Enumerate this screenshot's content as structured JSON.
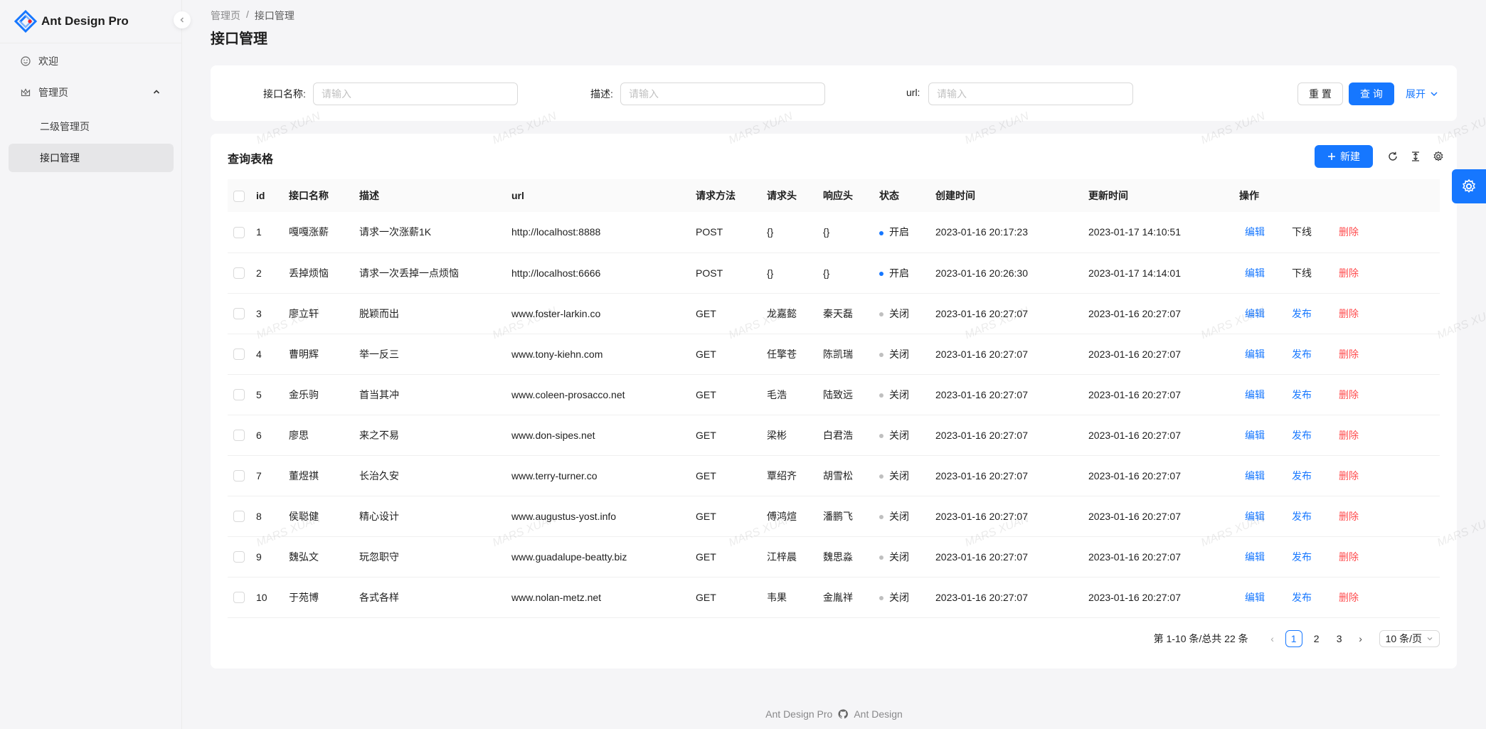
{
  "app": {
    "title": "Ant Design Pro"
  },
  "sidebar": {
    "items": [
      {
        "label": "欢迎",
        "icon": "smile-icon"
      },
      {
        "label": "管理页",
        "icon": "crown-icon"
      },
      {
        "label": "二级管理页"
      },
      {
        "label": "接口管理"
      }
    ]
  },
  "breadcrumb": [
    "管理页",
    "/",
    "接口管理"
  ],
  "page_title": "接口管理",
  "search": {
    "name_label": "接口名称:",
    "desc_label": "描述:",
    "url_label": "url:",
    "placeholder": "请输入",
    "reset": "重 置",
    "query": "查 询",
    "expand": "展开"
  },
  "table": {
    "title": "查询表格",
    "new_button": "新建",
    "columns": [
      "id",
      "接口名称",
      "描述",
      "url",
      "请求方法",
      "请求头",
      "响应头",
      "状态",
      "创建时间",
      "更新时间",
      "操作"
    ],
    "rows": [
      {
        "id": "1",
        "name": "嘎嘎涨薪",
        "desc": "请求一次涨薪1K",
        "url": "http://localhost:8888",
        "method": "POST",
        "req": "{}",
        "res": "{}",
        "status": "开启",
        "on": true,
        "created": "2023-01-16 20:17:23",
        "updated": "2023-01-17 14:10:51",
        "op1": "编辑",
        "op2": "下线",
        "op3": "删除"
      },
      {
        "id": "2",
        "name": "丢掉烦恼",
        "desc": "请求一次丢掉一点烦恼",
        "url": "http://localhost:6666",
        "method": "POST",
        "req": "{}",
        "res": "{}",
        "status": "开启",
        "on": true,
        "created": "2023-01-16 20:26:30",
        "updated": "2023-01-17 14:14:01",
        "op1": "编辑",
        "op2": "下线",
        "op3": "删除"
      },
      {
        "id": "3",
        "name": "廖立轩",
        "desc": "脱颖而出",
        "url": "www.foster-larkin.co",
        "method": "GET",
        "req": "龙嘉懿",
        "res": "秦天磊",
        "status": "关闭",
        "on": false,
        "created": "2023-01-16 20:27:07",
        "updated": "2023-01-16 20:27:07",
        "op1": "编辑",
        "op2": "发布",
        "op3": "删除"
      },
      {
        "id": "4",
        "name": "曹明辉",
        "desc": "举一反三",
        "url": "www.tony-kiehn.com",
        "method": "GET",
        "req": "任擎苍",
        "res": "陈凯瑞",
        "status": "关闭",
        "on": false,
        "created": "2023-01-16 20:27:07",
        "updated": "2023-01-16 20:27:07",
        "op1": "编辑",
        "op2": "发布",
        "op3": "删除"
      },
      {
        "id": "5",
        "name": "金乐驹",
        "desc": "首当其冲",
        "url": "www.coleen-prosacco.net",
        "method": "GET",
        "req": "毛浩",
        "res": "陆致远",
        "status": "关闭",
        "on": false,
        "created": "2023-01-16 20:27:07",
        "updated": "2023-01-16 20:27:07",
        "op1": "编辑",
        "op2": "发布",
        "op3": "删除"
      },
      {
        "id": "6",
        "name": "廖思",
        "desc": "来之不易",
        "url": "www.don-sipes.net",
        "method": "GET",
        "req": "梁彬",
        "res": "白君浩",
        "status": "关闭",
        "on": false,
        "created": "2023-01-16 20:27:07",
        "updated": "2023-01-16 20:27:07",
        "op1": "编辑",
        "op2": "发布",
        "op3": "删除"
      },
      {
        "id": "7",
        "name": "董煜祺",
        "desc": "长治久安",
        "url": "www.terry-turner.co",
        "method": "GET",
        "req": "覃绍齐",
        "res": "胡雪松",
        "status": "关闭",
        "on": false,
        "created": "2023-01-16 20:27:07",
        "updated": "2023-01-16 20:27:07",
        "op1": "编辑",
        "op2": "发布",
        "op3": "删除"
      },
      {
        "id": "8",
        "name": "侯聪健",
        "desc": "精心设计",
        "url": "www.augustus-yost.info",
        "method": "GET",
        "req": "傅鸿煊",
        "res": "潘鹏飞",
        "status": "关闭",
        "on": false,
        "created": "2023-01-16 20:27:07",
        "updated": "2023-01-16 20:27:07",
        "op1": "编辑",
        "op2": "发布",
        "op3": "删除"
      },
      {
        "id": "9",
        "name": "魏弘文",
        "desc": "玩忽职守",
        "url": "www.guadalupe-beatty.biz",
        "method": "GET",
        "req": "江梓晨",
        "res": "魏思淼",
        "status": "关闭",
        "on": false,
        "created": "2023-01-16 20:27:07",
        "updated": "2023-01-16 20:27:07",
        "op1": "编辑",
        "op2": "发布",
        "op3": "删除"
      },
      {
        "id": "10",
        "name": "于苑博",
        "desc": "各式各样",
        "url": "www.nolan-metz.net",
        "method": "GET",
        "req": "韦果",
        "res": "金胤祥",
        "status": "关闭",
        "on": false,
        "created": "2023-01-16 20:27:07",
        "updated": "2023-01-16 20:27:07",
        "op1": "编辑",
        "op2": "发布",
        "op3": "删除"
      }
    ]
  },
  "pagination": {
    "total_text": "第 1-10 条/总共 22 条",
    "pages": [
      "1",
      "2",
      "3"
    ],
    "page_size": "10 条/页"
  },
  "footer": {
    "left": "Ant Design Pro",
    "right": "Ant Design"
  },
  "watermark": "MARS XUAN",
  "colors": {
    "primary": "#1677ff",
    "danger": "#ff4d4f",
    "status_on": "#1677ff",
    "status_off": "#bfbfbf"
  }
}
